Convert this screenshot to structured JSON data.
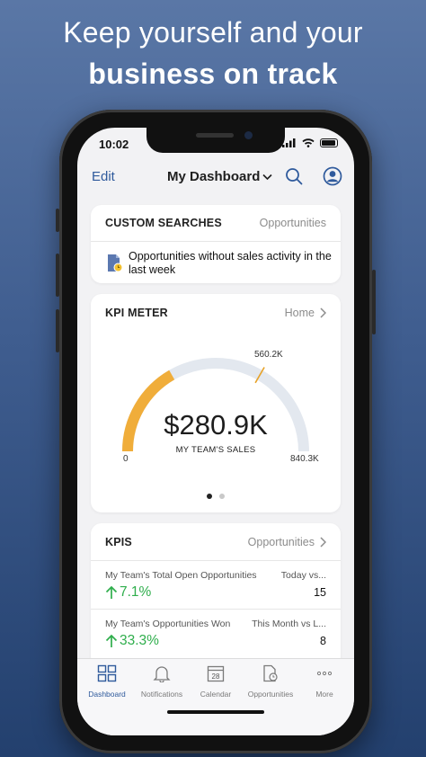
{
  "headline": {
    "line1": "Keep yourself and your",
    "line2": "business on track"
  },
  "colors": {
    "accent": "#2f5a9c",
    "gauge_fill": "#f0ad3a",
    "gauge_track": "#e3e8ef",
    "positive": "#2fae4c"
  },
  "status_bar": {
    "time": "10:02"
  },
  "nav": {
    "edit": "Edit",
    "title": "My Dashboard",
    "title_icon": "chevron-down-icon",
    "search_icon": "search-icon",
    "profile_icon": "profile-icon"
  },
  "custom_searches": {
    "title": "CUSTOM SEARCHES",
    "link": "Opportunities",
    "item": "Opportunities without sales activity in the last week",
    "item_icon": "document-clock-icon"
  },
  "kpi_meter": {
    "title": "KPI METER",
    "link": "Home",
    "value": "$280.9K",
    "label": "MY TEAM'S SALES",
    "min_label": "0",
    "max_label": "840.3K",
    "target_label": "560.2K",
    "fill_fraction": 0.334,
    "target_fraction": 0.667,
    "page_count": 2,
    "active_page": 1
  },
  "kpis": {
    "title": "KPIS",
    "link": "Opportunities",
    "rows": [
      {
        "name": "My Team's Total Open Opportunities",
        "period": "Today vs...",
        "change": "7.1%",
        "direction": "up",
        "count": "15"
      },
      {
        "name": "My Team's Opportunities Won",
        "period": "This Month vs L...",
        "change": "33.3%",
        "direction": "up",
        "count": "8"
      }
    ]
  },
  "tabbar": {
    "tabs": [
      {
        "label": "Dashboard",
        "icon": "dashboard-icon",
        "active": true
      },
      {
        "label": "Notifications",
        "icon": "bell-icon",
        "active": false
      },
      {
        "label": "Calendar",
        "icon": "calendar-icon",
        "calendar_day": "28",
        "active": false
      },
      {
        "label": "Opportunities",
        "icon": "opportunities-icon",
        "active": false
      },
      {
        "label": "More",
        "icon": "more-icon",
        "active": false
      }
    ]
  }
}
